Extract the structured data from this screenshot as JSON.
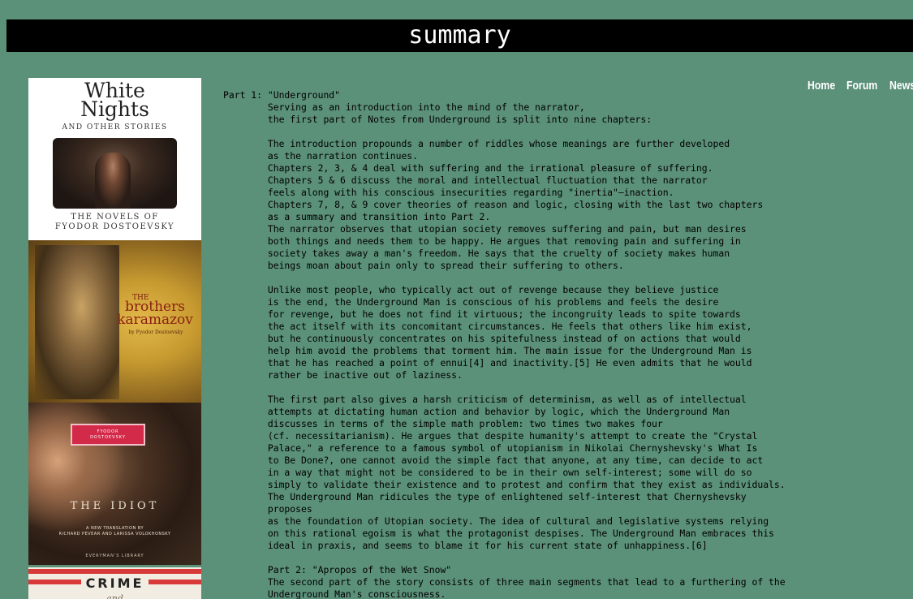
{
  "page": {
    "title": "summary"
  },
  "nav": {
    "items": [
      "Home",
      "Forum",
      "News"
    ]
  },
  "covers": [
    {
      "title_line1": "White",
      "title_line2": "Nights",
      "subtitle": "AND OTHER STORIES",
      "footer_line1": "THE NOVELS OF",
      "footer_line2": "FYODOR DOSTOEVSKY"
    },
    {
      "the": "THE",
      "title_line1": "brothers",
      "title_line2": "karamazov",
      "byline": "by Fyodor Dostoevsky"
    },
    {
      "author_line1": "FYODOR",
      "author_line2": "DOSTOEVSKY",
      "title": "THE IDIOT",
      "translation_line1": "A NEW TRANSLATION BY",
      "translation_line2": "RICHARD PEVEAR AND LARISSA VOLOKHONSKY",
      "publisher": "EVERYMAN'S LIBRARY"
    },
    {
      "title": "CRIME",
      "and": "and"
    }
  ],
  "summary": {
    "lines": [
      "Part 1: \"Underground\"",
      "        Serving as an introduction into the mind of the narrator,",
      "        the first part of Notes from Underground is split into nine chapters:",
      "",
      "        The introduction propounds a number of riddles whose meanings are further developed",
      "        as the narration continues.",
      "        Chapters 2, 3, & 4 deal with suffering and the irrational pleasure of suffering.",
      "        Chapters 5 & 6 discuss the moral and intellectual fluctuation that the narrator",
      "        feels along with his conscious insecurities regarding \"inertia\"—inaction.",
      "        Chapters 7, 8, & 9 cover theories of reason and logic, closing with the last two chapters",
      "        as a summary and transition into Part 2.",
      "        The narrator observes that utopian society removes suffering and pain, but man desires",
      "        both things and needs them to be happy. He argues that removing pain and suffering in",
      "        society takes away a man's freedom. He says that the cruelty of society makes human",
      "        beings moan about pain only to spread their suffering to others.",
      "",
      "        Unlike most people, who typically act out of revenge because they believe justice",
      "        is the end, the Underground Man is conscious of his problems and feels the desire",
      "        for revenge, but he does not find it virtuous; the incongruity leads to spite towards",
      "        the act itself with its concomitant circumstances. He feels that others like him exist,",
      "        but he continuously concentrates on his spitefulness instead of on actions that would",
      "        help him avoid the problems that torment him. The main issue for the Underground Man is",
      "        that he has reached a point of ennui[4] and inactivity.[5] He even admits that he would",
      "        rather be inactive out of laziness.",
      "",
      "        The first part also gives a harsh criticism of determinism, as well as of intellectual",
      "        attempts at dictating human action and behavior by logic, which the Underground Man",
      "        discusses in terms of the simple math problem: two times two makes four",
      "        (cf. necessitarianism). He argues that despite humanity's attempt to create the \"Crystal",
      "        Palace,\" a reference to a famous symbol of utopianism in Nikolai Chernyshevsky's What Is",
      "        to Be Done?, one cannot avoid the simple fact that anyone, at any time, can decide to act",
      "        in a way that might not be considered to be in their own self-interest; some will do so",
      "        simply to validate their existence and to protest and confirm that they exist as individuals.",
      "        The Underground Man ridicules the type of enlightened self-interest that Chernyshevsky",
      "        proposes",
      "        as the foundation of Utopian society. The idea of cultural and legislative systems relying",
      "        on this rational egoism is what the protagonist despises. The Underground Man embraces this",
      "        ideal in praxis, and seems to blame it for his current state of unhappiness.[6]",
      "",
      "        Part 2: \"Apropos of the Wet Snow\"",
      "        The second part of the story consists of three main segments that lead to a furthering of the",
      "        Underground Man's consciousness."
    ]
  },
  "colors": {
    "background": "#5b9079",
    "title_bar": "#000000",
    "title_text": "#ffffff",
    "nav_text": "#ffffff",
    "body_text": "#000000"
  }
}
